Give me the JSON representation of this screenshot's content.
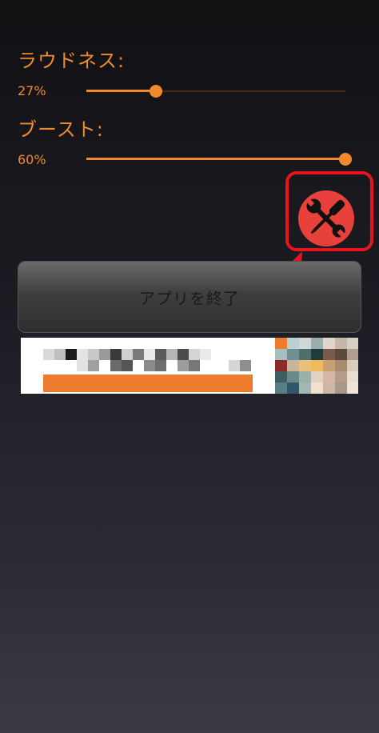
{
  "loudness": {
    "label": "ラウドネス:",
    "value_text": "27%",
    "value": 0.27
  },
  "boost": {
    "label": "ブースト:",
    "value_text": "60%",
    "value": 1.0
  },
  "exit_button": {
    "label": "アプリを終了"
  },
  "colors": {
    "accent": "#f08a2c",
    "highlight": "#e8141c",
    "tool_bg": "#e8413b"
  },
  "icons": {
    "tools": "wrench-screwdriver-icon",
    "annotation": "arrow-icon"
  }
}
